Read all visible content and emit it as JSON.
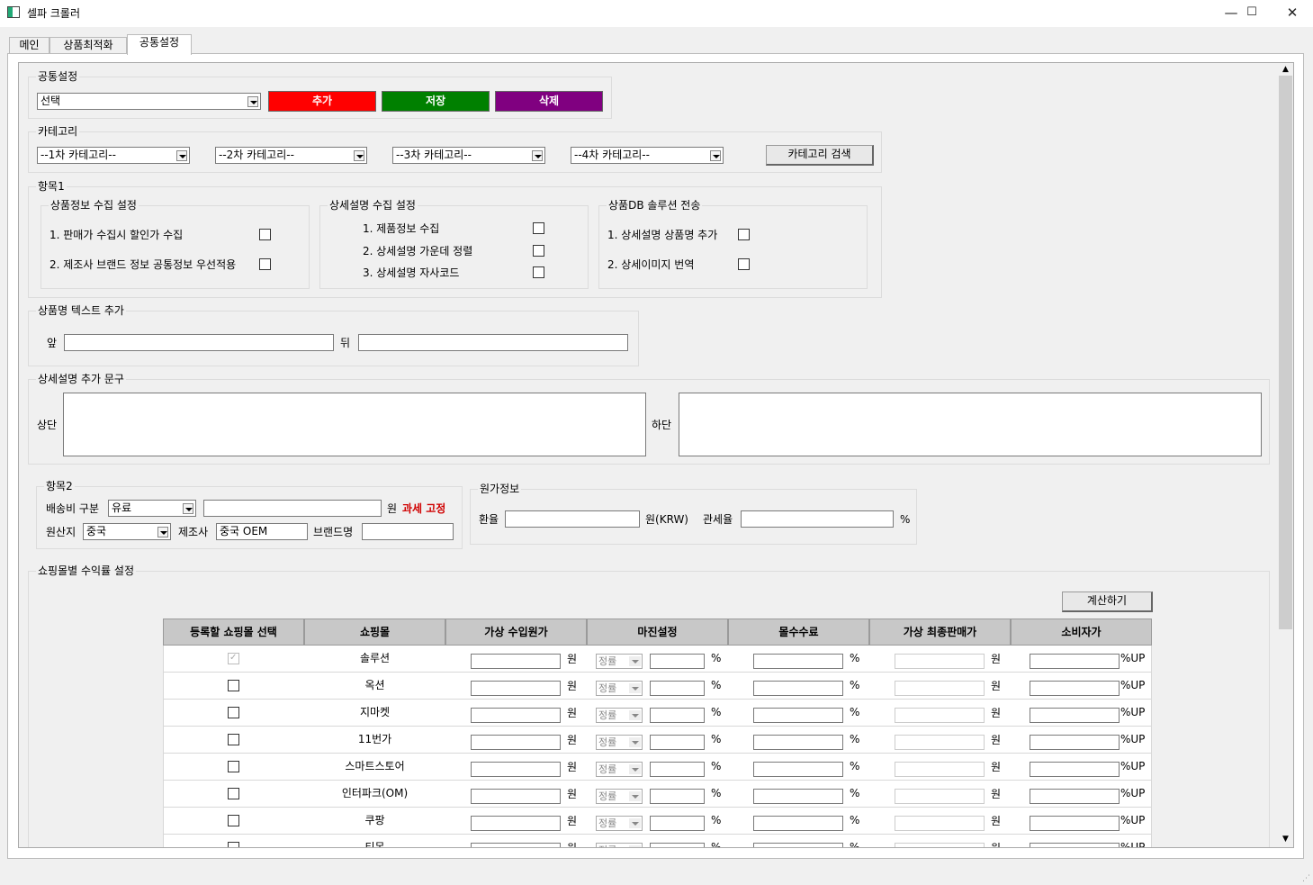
{
  "window": {
    "title": "셀파 크롤러",
    "minimize": "—",
    "maximize": "☐",
    "close": "✕"
  },
  "tabs": [
    "메인",
    "상품최적화",
    "공통설정"
  ],
  "common": {
    "label": "공통설정",
    "select": "선택",
    "add": "추가",
    "save": "저장",
    "delete": "삭제",
    "colors": {
      "add": "#ff0000",
      "save": "#008000",
      "delete": "#800080"
    }
  },
  "category": {
    "label": "카테고리",
    "c1": "--1차 카테고리--",
    "c2": "--2차 카테고리--",
    "c3": "--3차 카테고리--",
    "c4": "--4차 카테고리--",
    "search": "카테고리 검색"
  },
  "item1": {
    "label": "항목1",
    "g1": {
      "label": "상품정보 수집 설정",
      "o1": "1. 판매가 수집시 할인가 수집",
      "o2": "2. 제조사 브랜드 정보 공통정보 우선적용"
    },
    "g2": {
      "label": "상세설명 수집 설정",
      "o1": "1. 제품정보 수집",
      "o2": "2. 상세설명 가운데 정렬",
      "o3": "3. 상세설명 자사코드"
    },
    "g3": {
      "label": "상품DB 솔루션 전송",
      "o1": "1. 상세설명 상품명 추가",
      "o2": "2. 상세이미지 번역"
    }
  },
  "nametext": {
    "label": "상품명 텍스트 추가",
    "front": "앞",
    "back": "뒤"
  },
  "detail": {
    "label": "상세설명 추가 문구",
    "top": "상단",
    "bottom": "하단"
  },
  "item2": {
    "label": "항목2",
    "ship": "배송비 구분",
    "ship_val": "유료",
    "won": "원",
    "tax": "과세 고정",
    "origin": "원산지",
    "origin_val": "중국",
    "maker": "제조사",
    "maker_val": "중국 OEM",
    "brand": "브랜드명"
  },
  "cost": {
    "label": "원가정보",
    "rate": "환율",
    "krw": "원(KRW)",
    "duty": "관세율",
    "pct": "%"
  },
  "margin": {
    "label": "쇼핑몰별 수익률 설정",
    "calc": "계산하기",
    "headers": [
      "등록할 쇼핑몰 선택",
      "쇼핑몰",
      "가상 수입원가",
      "마진설정",
      "몰수수료",
      "가상 최종판매가",
      "소비자가"
    ],
    "won": "원",
    "pct": "%",
    "pctup": "%UP",
    "mode": "정률",
    "rows": [
      "솔루션",
      "옥션",
      "지마켓",
      "11번가",
      "스마트스토어",
      "인터파크(OM)",
      "쿠팡",
      "티몬"
    ]
  }
}
